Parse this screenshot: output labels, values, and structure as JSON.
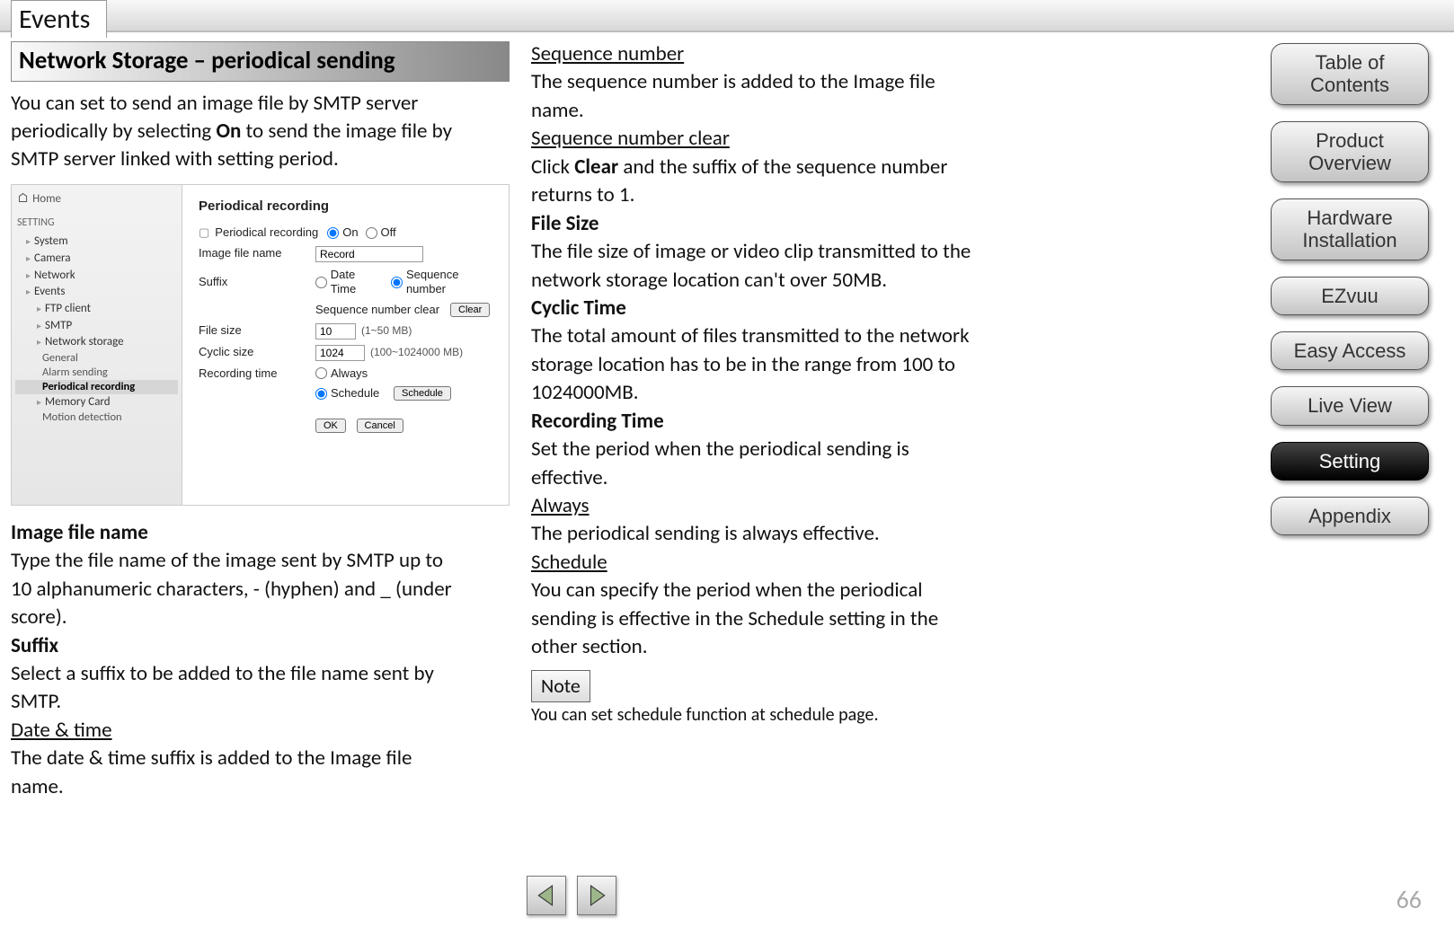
{
  "tab": {
    "label": "Events"
  },
  "section_title": "Network Storage – periodical sending",
  "intro": {
    "line1": "You can set to send an image file by SMTP server",
    "line2_pre": "periodically by selecting ",
    "line2_bold": "On",
    "line2_post": " to send the image file by",
    "line3": "SMTP server linked with setting period."
  },
  "left": {
    "h1": "Image file name",
    "p1a": "Type the file name of the image sent by SMTP up to",
    "p1b": "10 alphanumeric characters, - (hyphen) and _ (under",
    "p1c": "score).",
    "h2": "Suffix",
    "p2a": "Select a suffix to be added to the file name sent by",
    "p2b": "SMTP.",
    "u1": "Date & time",
    "p3a": "The date & time suffix is added to the Image file",
    "p3b": "name."
  },
  "right": {
    "u1": "Sequence number",
    "p1a": "The sequence number is added to the Image file",
    "p1b": "name.",
    "u2": "Sequence number clear",
    "p2a_pre": "Click ",
    "p2a_bold": "Clear",
    "p2a_post": " and the suffix of the sequence number",
    "p2b": "returns to 1.",
    "h3": "File Size",
    "p3a": "The file size of image or video clip transmitted to the",
    "p3b": "network storage location can't over 50MB.",
    "h4": "Cyclic Time",
    "p4a": "The total amount of files transmitted to the network",
    "p4b": "storage location has to be in the range from 100 to",
    "p4c": "1024000MB.",
    "h5": "Recording Time",
    "p5a": "Set the period when the periodical sending is",
    "p5b": "effective.",
    "u3": "Always",
    "p6": "The periodical sending is always effective.",
    "u4": "Schedule",
    "p7a": "You can specify the period when the periodical",
    "p7b": "sending is effective in the Schedule setting in the",
    "p7c": "other section.",
    "note_label": "Note",
    "note_text": "You can set schedule function at schedule page."
  },
  "screenshot": {
    "home": "Home",
    "nav_hdr": "SETTING",
    "nav": [
      "System",
      "Camera",
      "Network",
      "Events"
    ],
    "nav_sub": [
      "FTP client",
      "SMTP",
      "Network storage"
    ],
    "nav_sub2": [
      "General",
      "Alarm sending",
      "Periodical recording"
    ],
    "nav_tail": [
      "Memory Card",
      "Motion detection"
    ],
    "title": "Periodical recording",
    "row_periodical": "Periodical recording",
    "opt_on": "On",
    "opt_off": "Off",
    "row_filename": "Image file name",
    "val_filename": "Record",
    "row_suffix": "Suffix",
    "opt_datetime": "Date Time",
    "opt_seqnum": "Sequence number",
    "row_seqclear": "Sequence number clear",
    "btn_clear": "Clear",
    "row_filesize": "File size",
    "val_filesize": "10",
    "unit_filesize": "(1~50 MB)",
    "row_cyclic": "Cyclic size",
    "val_cyclic": "1024",
    "unit_cyclic": "(100~1024000 MB)",
    "row_rectime": "Recording time",
    "opt_always": "Always",
    "opt_schedule": "Schedule",
    "btn_schedule": "Schedule",
    "btn_ok": "OK",
    "btn_cancel": "Cancel"
  },
  "side": {
    "toc": "Table of Contents",
    "overview": "Product Overview",
    "hardware": "Hardware Installation",
    "ezvuu": "EZvuu",
    "easy": "Easy Access",
    "live": "Live View",
    "setting": "Setting",
    "appendix": "Appendix"
  },
  "page_number": "66"
}
